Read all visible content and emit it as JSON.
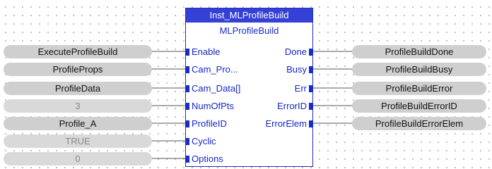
{
  "function_block": {
    "instance_name": "Inst_MLProfileBuild",
    "type_name": "MLProfileBuild",
    "inputs": [
      {
        "pin": "Enable",
        "variable": "ExecuteProfileBuild",
        "constant": false
      },
      {
        "pin": "Cam_Pro...",
        "variable": "ProfileProps",
        "constant": false
      },
      {
        "pin": "Cam_Data[]",
        "variable": "ProfileData",
        "constant": false
      },
      {
        "pin": "NumOfPts",
        "variable": "3",
        "constant": true
      },
      {
        "pin": "ProfileID",
        "variable": "Profile_A",
        "constant": false
      },
      {
        "pin": "Cyclic",
        "variable": "TRUE",
        "constant": true
      },
      {
        "pin": "Options",
        "variable": "0",
        "constant": true
      }
    ],
    "outputs": [
      {
        "pin": "Done",
        "variable": "ProfileBuildDone"
      },
      {
        "pin": "Busy",
        "variable": "ProfileBuildBusy"
      },
      {
        "pin": "Err",
        "variable": "ProfileBuildError"
      },
      {
        "pin": "ErrorID",
        "variable": "ProfileBuildErrorID"
      },
      {
        "pin": "ErrorElem",
        "variable": "ProfileBuildErrorElem"
      }
    ]
  },
  "colors": {
    "block_border": "#1f2db8",
    "title_bar": "#3541d6",
    "pin_text": "#1626c8",
    "variable_fill": "#cfcfcf",
    "wire": "#555555"
  }
}
